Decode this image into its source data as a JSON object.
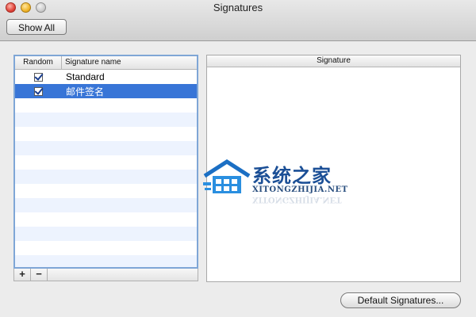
{
  "window": {
    "title": "Signatures"
  },
  "toolbar": {
    "show_all_label": "Show All"
  },
  "table": {
    "headers": {
      "random": "Random",
      "name": "Signature name"
    },
    "rows": [
      {
        "name": "Standard",
        "random_checked": true,
        "selected": false
      },
      {
        "name": "邮件签名",
        "random_checked": true,
        "selected": true
      }
    ]
  },
  "controls": {
    "add_label": "+",
    "remove_label": "−"
  },
  "preview": {
    "header": "Signature"
  },
  "footer": {
    "default_signatures_label": "Default Signatures..."
  },
  "watermark": {
    "chinese": "系统之家",
    "domain": "XITONGZHIJIA.NET"
  },
  "colors": {
    "selection": "#3875d7",
    "alt_row": "#edf3fe",
    "watermark": "#1b4f96"
  }
}
